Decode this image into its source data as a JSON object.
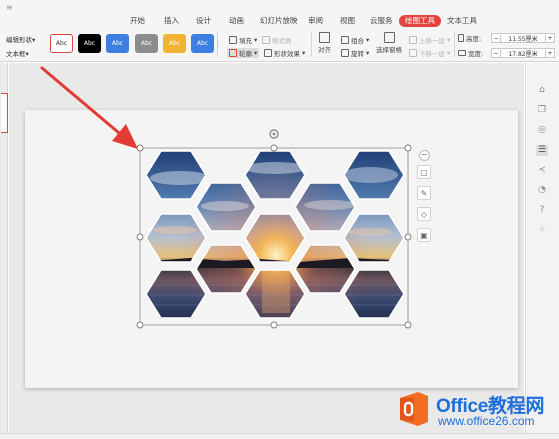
{
  "menubar": {
    "app_icon": "≡",
    "tabs": [
      {
        "label": "开始",
        "active": false
      },
      {
        "label": "插入",
        "active": false
      },
      {
        "label": "设计",
        "active": false
      },
      {
        "label": "动画",
        "active": false
      },
      {
        "label": "幻灯片放映",
        "active": false
      },
      {
        "label": "审阅",
        "active": false
      },
      {
        "label": "视图",
        "active": false
      },
      {
        "label": "云服务",
        "active": false
      },
      {
        "label": "绘图工具",
        "active": true
      },
      {
        "label": "文本工具",
        "active": false
      }
    ]
  },
  "ribbon": {
    "edit_shape": "编辑形状",
    "text_box": "文本框",
    "styles": [
      {
        "label": "Abc",
        "color": "#ffffff"
      },
      {
        "label": "Abc",
        "color": "#000000"
      },
      {
        "label": "Abc",
        "color": "#3d7fe0"
      },
      {
        "label": "Abc",
        "color": "#8c8c8c"
      },
      {
        "label": "Abc",
        "color": "#f2b233"
      },
      {
        "label": "Abc",
        "color": "#3d7fe0"
      }
    ],
    "fill": "填充",
    "format_painter": "格式刷",
    "outline": "轮廓",
    "shape_effects": "形状效果",
    "align": "对齐",
    "group": "组合",
    "rotate": "旋转",
    "selection_pane": "选择窗格",
    "bring_forward": "上移一层",
    "send_backward": "下移一层",
    "height_label": "高度:",
    "height_value": "11.55厘米",
    "width_label": "宽度:",
    "width_value": "17.82厘米",
    "minus": "−",
    "plus": "+"
  },
  "colors": {
    "accent": "#e0453f",
    "brand_blue": "#1e6fd9",
    "watermark_orange": "#f26c22"
  },
  "watermark": {
    "brand": "Office教程网",
    "site": "www.office26.com"
  },
  "float_toolbar": {
    "collapse": "−",
    "icons": [
      "shape-style-icon",
      "pen-icon",
      "fill-icon",
      "layout-icon"
    ]
  },
  "right_sidebar": {
    "icons": [
      "pin-icon",
      "copy-icon",
      "shapes-icon",
      "properties-icon",
      "share-icon",
      "history-icon",
      "help-icon",
      "more-icon"
    ]
  }
}
